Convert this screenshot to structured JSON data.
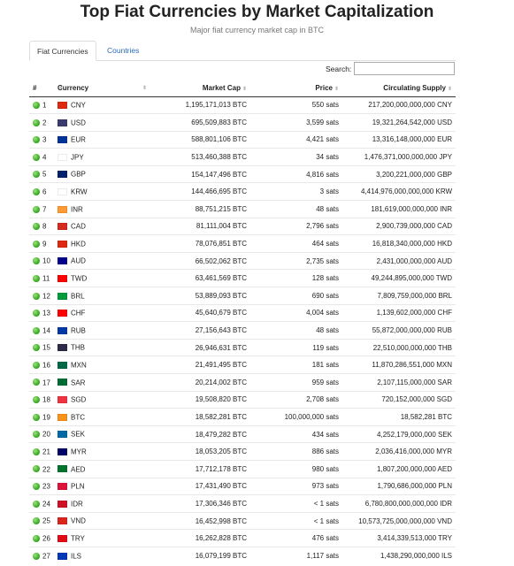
{
  "page": {
    "title": "Top Fiat Currencies by Market Capitalization",
    "subtitle": "Major fiat currency market cap in BTC"
  },
  "tabs": [
    {
      "label": "Fiat Currencies",
      "active": true
    },
    {
      "label": "Countries",
      "active": false
    }
  ],
  "search": {
    "label": "Search:",
    "value": ""
  },
  "table": {
    "headers": {
      "rank": "#",
      "currency": "Currency",
      "market_cap": "Market Cap",
      "price": "Price",
      "supply": "Circulating Supply"
    },
    "rows": [
      {
        "rank": "1",
        "code": "CNY",
        "flag": "#de2910",
        "market_cap": "1,195,171,013 BTC",
        "price": "550 sats",
        "supply": "217,200,000,000,000 CNY"
      },
      {
        "rank": "2",
        "code": "USD",
        "flag": "#3c3b6e",
        "market_cap": "695,509,883 BTC",
        "price": "3,599 sats",
        "supply": "19,321,264,542,000 USD"
      },
      {
        "rank": "3",
        "code": "EUR",
        "flag": "#003399",
        "market_cap": "588,801,106 BTC",
        "price": "4,421 sats",
        "supply": "13,316,148,000,000 EUR"
      },
      {
        "rank": "4",
        "code": "JPY",
        "flag": "#ffffff",
        "market_cap": "513,460,388 BTC",
        "price": "34 sats",
        "supply": "1,476,371,000,000,000 JPY"
      },
      {
        "rank": "5",
        "code": "GBP",
        "flag": "#012169",
        "market_cap": "154,147,496 BTC",
        "price": "4,816 sats",
        "supply": "3,200,221,000,000 GBP"
      },
      {
        "rank": "6",
        "code": "KRW",
        "flag": "#ffffff",
        "market_cap": "144,466,695 BTC",
        "price": "3 sats",
        "supply": "4,414,976,000,000,000 KRW"
      },
      {
        "rank": "7",
        "code": "INR",
        "flag": "#ff9933",
        "market_cap": "88,751,215 BTC",
        "price": "48 sats",
        "supply": "181,619,000,000,000 INR"
      },
      {
        "rank": "8",
        "code": "CAD",
        "flag": "#d52b1e",
        "market_cap": "81,111,004 BTC",
        "price": "2,796 sats",
        "supply": "2,900,739,000,000 CAD"
      },
      {
        "rank": "9",
        "code": "HKD",
        "flag": "#de2910",
        "market_cap": "78,076,851 BTC",
        "price": "464 sats",
        "supply": "16,818,340,000,000 HKD"
      },
      {
        "rank": "10",
        "code": "AUD",
        "flag": "#00008b",
        "market_cap": "66,502,062 BTC",
        "price": "2,735 sats",
        "supply": "2,431,000,000,000 AUD"
      },
      {
        "rank": "11",
        "code": "TWD",
        "flag": "#fe0000",
        "market_cap": "63,461,569 BTC",
        "price": "128 sats",
        "supply": "49,244,895,000,000 TWD"
      },
      {
        "rank": "12",
        "code": "BRL",
        "flag": "#009c3b",
        "market_cap": "53,889,093 BTC",
        "price": "690 sats",
        "supply": "7,809,759,000,000 BRL"
      },
      {
        "rank": "13",
        "code": "CHF",
        "flag": "#ff0000",
        "market_cap": "45,640,679 BTC",
        "price": "4,004 sats",
        "supply": "1,139,602,000,000 CHF"
      },
      {
        "rank": "14",
        "code": "RUB",
        "flag": "#0039a6",
        "market_cap": "27,156,643 BTC",
        "price": "48 sats",
        "supply": "55,872,000,000,000 RUB"
      },
      {
        "rank": "15",
        "code": "THB",
        "flag": "#2d2a4a",
        "market_cap": "26,946,631 BTC",
        "price": "119 sats",
        "supply": "22,510,000,000,000 THB"
      },
      {
        "rank": "16",
        "code": "MXN",
        "flag": "#006847",
        "market_cap": "21,491,495 BTC",
        "price": "181 sats",
        "supply": "11,870,286,551,000 MXN"
      },
      {
        "rank": "17",
        "code": "SAR",
        "flag": "#006c35",
        "market_cap": "20,214,002 BTC",
        "price": "959 sats",
        "supply": "2,107,115,000,000 SAR"
      },
      {
        "rank": "18",
        "code": "SGD",
        "flag": "#ef3340",
        "market_cap": "19,508,820 BTC",
        "price": "2,708 sats",
        "supply": "720,152,000,000 SGD"
      },
      {
        "rank": "19",
        "code": "BTC",
        "flag": "#f7931a",
        "market_cap": "18,582,281 BTC",
        "price": "100,000,000 sats",
        "supply": "18,582,281 BTC"
      },
      {
        "rank": "20",
        "code": "SEK",
        "flag": "#006aa7",
        "market_cap": "18,479,282 BTC",
        "price": "434 sats",
        "supply": "4,252,179,000,000 SEK"
      },
      {
        "rank": "21",
        "code": "MYR",
        "flag": "#010066",
        "market_cap": "18,053,205 BTC",
        "price": "886 sats",
        "supply": "2,036,416,000,000 MYR"
      },
      {
        "rank": "22",
        "code": "AED",
        "flag": "#00732f",
        "market_cap": "17,712,178 BTC",
        "price": "980 sats",
        "supply": "1,807,200,000,000 AED"
      },
      {
        "rank": "23",
        "code": "PLN",
        "flag": "#dc143c",
        "market_cap": "17,431,490 BTC",
        "price": "973 sats",
        "supply": "1,790,686,000,000 PLN"
      },
      {
        "rank": "24",
        "code": "IDR",
        "flag": "#ce1126",
        "market_cap": "17,306,346 BTC",
        "price": "< 1 sats",
        "supply": "6,780,800,000,000,000 IDR"
      },
      {
        "rank": "25",
        "code": "VND",
        "flag": "#da251d",
        "market_cap": "16,452,998 BTC",
        "price": "< 1 sats",
        "supply": "10,573,725,000,000,000 VND"
      },
      {
        "rank": "26",
        "code": "TRY",
        "flag": "#e30a17",
        "market_cap": "16,262,828 BTC",
        "price": "476 sats",
        "supply": "3,414,339,513,000 TRY"
      },
      {
        "rank": "27",
        "code": "ILS",
        "flag": "#0038b8",
        "market_cap": "16,079,199 BTC",
        "price": "1,117 sats",
        "supply": "1,438,290,000,000 ILS"
      }
    ]
  }
}
